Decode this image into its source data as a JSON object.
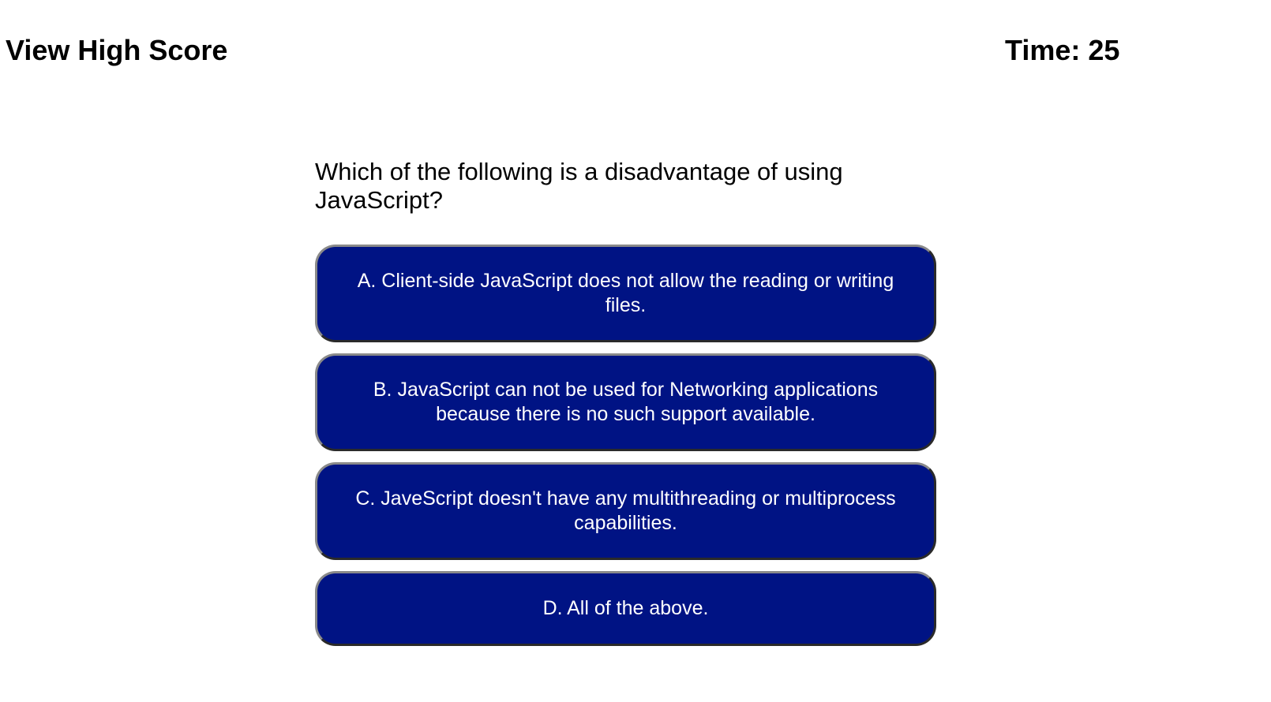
{
  "header": {
    "high_score_link": "View High Score",
    "timer_label": "Time:",
    "timer_value": "25"
  },
  "quiz": {
    "question": "Which of the following is a disadvantage of using JavaScript?",
    "answers": [
      {
        "label": "A. Client-side JavaScript does not allow the reading or writing files."
      },
      {
        "label": "B. JavaScript can not be used for Networking applications because there is no such support available."
      },
      {
        "label": "C. JaveScript doesn't have any multithreading or multiprocess capabilities."
      },
      {
        "label": "D. All of the above."
      }
    ]
  },
  "colors": {
    "button_background": "#001384",
    "button_text": "#ffffff",
    "page_background": "#ffffff"
  }
}
